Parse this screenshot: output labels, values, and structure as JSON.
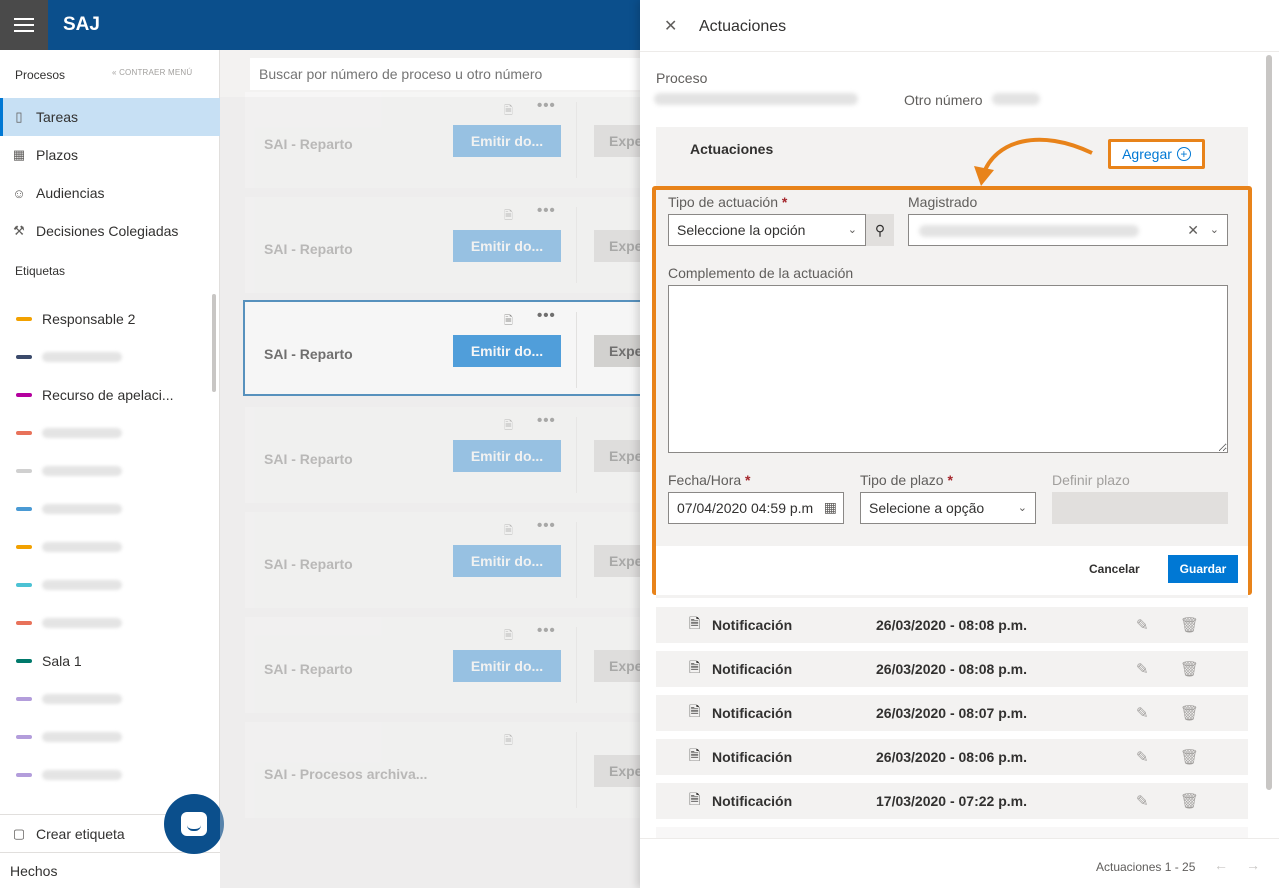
{
  "app": {
    "brand": "SAJ"
  },
  "sidebar": {
    "processes_title": "Procesos",
    "collapse_label": "CONTRAER MENÚ",
    "items": [
      {
        "label": "Tareas",
        "icon": "bookmark-icon",
        "active": true
      },
      {
        "label": "Plazos",
        "icon": "calendar-icon"
      },
      {
        "label": "Audiencias",
        "icon": "people-icon"
      },
      {
        "label": "Decisiones Colegiadas",
        "icon": "gavel-icon"
      }
    ],
    "tags_title": "Etiquetas",
    "tags": [
      {
        "label": "Responsable 2",
        "color": "#f2a100"
      },
      {
        "label": "",
        "color": "#3b4a6b"
      },
      {
        "label": "Recurso de apelaci...",
        "color": "#b4009e"
      },
      {
        "label": "",
        "color": "#e8725a"
      },
      {
        "label": "",
        "color": "#d0d0d0"
      },
      {
        "label": "",
        "color": "#4a9ad4"
      },
      {
        "label": "",
        "color": "#f2a100"
      },
      {
        "label": "",
        "color": "#4cc2d4"
      },
      {
        "label": "",
        "color": "#e8725a"
      },
      {
        "label": "Sala 1",
        "color": "#00796b"
      },
      {
        "label": "",
        "color": "#b39ddb"
      },
      {
        "label": "",
        "color": "#b39ddb"
      },
      {
        "label": "",
        "color": "#b39ddb"
      }
    ],
    "create_tag": "Crear etiqueta",
    "hechos": "Hechos"
  },
  "main": {
    "search_placeholder": "Buscar por número de proceso u otro número",
    "cards": [
      {
        "title": "SAI - Reparto",
        "emit": "Emitir do...",
        "exp": "Expe"
      },
      {
        "title": "SAI - Reparto",
        "emit": "Emitir do...",
        "exp": "Expe"
      },
      {
        "title": "SAI - Reparto",
        "emit": "Emitir do...",
        "exp": "Expe"
      },
      {
        "title": "SAI - Reparto",
        "emit": "Emitir do...",
        "exp": "Expe"
      },
      {
        "title": "SAI - Reparto",
        "emit": "Emitir do...",
        "exp": "Expe"
      },
      {
        "title": "SAI - Reparto",
        "emit": "Emitir do...",
        "exp": "Expe"
      },
      {
        "title": "SAI - Procesos archiva...",
        "emit": "",
        "exp": "Expe"
      }
    ]
  },
  "panel": {
    "title": "Actuaciones",
    "proceso_label": "Proceso",
    "otro_numero_label": "Otro número",
    "section_title": "Actuaciones",
    "add_label": "Agregar",
    "form": {
      "tipo_label": "Tipo de actuación",
      "tipo_value": "Seleccione la opción",
      "magistrado_label": "Magistrado",
      "complemento_label": "Complemento de la actuación",
      "fecha_label": "Fecha/Hora",
      "fecha_value": "07/04/2020 04:59 p.m",
      "plazo_label": "Tipo de plazo",
      "plazo_value": "Selecione a opção",
      "definir_label": "Definir plazo",
      "required_mark": "*",
      "cancel": "Cancelar",
      "save": "Guardar"
    },
    "list": [
      {
        "name": "Notificación",
        "date": "26/03/2020 - 08:08 p.m."
      },
      {
        "name": "Notificación",
        "date": "26/03/2020 - 08:08 p.m."
      },
      {
        "name": "Notificación",
        "date": "26/03/2020 - 08:07 p.m."
      },
      {
        "name": "Notificación",
        "date": "26/03/2020 - 08:06 p.m."
      },
      {
        "name": "Notificación",
        "date": "17/03/2020 - 07:22 p.m."
      }
    ],
    "pager": "Actuaciones 1 - 25",
    "accent": "#e8831a"
  }
}
